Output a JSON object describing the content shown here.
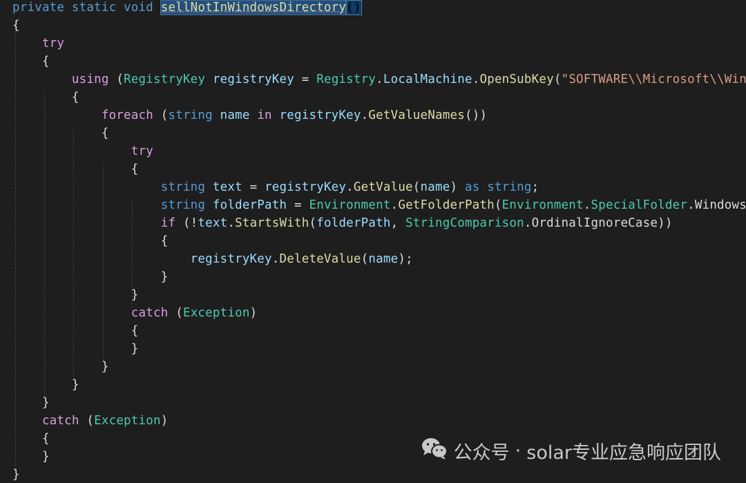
{
  "editor": {
    "lines": [
      [
        {
          "t": "private static void ",
          "c": "kw"
        },
        {
          "t": "sellNotInWindowsDirectory",
          "c": "sel"
        },
        {
          "t": "()",
          "c": "paren-hl"
        }
      ],
      [
        {
          "t": "{",
          "c": "pl"
        }
      ],
      [
        {
          "t": "    try",
          "c": "ctl"
        }
      ],
      [
        {
          "t": "    {",
          "c": "pl"
        }
      ],
      [
        {
          "t": "        using ",
          "c": "ctl"
        },
        {
          "t": "(",
          "c": "pl"
        },
        {
          "t": "RegistryKey ",
          "c": "type"
        },
        {
          "t": "registryKey ",
          "c": "id"
        },
        {
          "t": "= ",
          "c": "pl"
        },
        {
          "t": "Registry",
          "c": "type"
        },
        {
          "t": ".",
          "c": "pl"
        },
        {
          "t": "LocalMachine",
          "c": "id"
        },
        {
          "t": ".",
          "c": "pl"
        },
        {
          "t": "OpenSubKey",
          "c": "fn"
        },
        {
          "t": "(",
          "c": "pl"
        },
        {
          "t": "\"SOFTWARE\\\\Microsoft\\\\Windo",
          "c": "str"
        }
      ],
      [
        {
          "t": "        {",
          "c": "pl"
        }
      ],
      [
        {
          "t": "            foreach ",
          "c": "ctl"
        },
        {
          "t": "(",
          "c": "pl"
        },
        {
          "t": "string ",
          "c": "kw"
        },
        {
          "t": "name ",
          "c": "id"
        },
        {
          "t": "in ",
          "c": "ctl"
        },
        {
          "t": "registryKey",
          "c": "id"
        },
        {
          "t": ".",
          "c": "pl"
        },
        {
          "t": "GetValueNames",
          "c": "fn"
        },
        {
          "t": "())",
          "c": "pl"
        }
      ],
      [
        {
          "t": "            {",
          "c": "pl"
        }
      ],
      [
        {
          "t": "                try",
          "c": "ctl"
        }
      ],
      [
        {
          "t": "                {",
          "c": "pl"
        }
      ],
      [
        {
          "t": "                    string ",
          "c": "kw"
        },
        {
          "t": "text ",
          "c": "id"
        },
        {
          "t": "= ",
          "c": "pl"
        },
        {
          "t": "registryKey",
          "c": "id"
        },
        {
          "t": ".",
          "c": "pl"
        },
        {
          "t": "GetValue",
          "c": "fn"
        },
        {
          "t": "(",
          "c": "pl"
        },
        {
          "t": "name",
          "c": "id"
        },
        {
          "t": ") ",
          "c": "pl"
        },
        {
          "t": "as ",
          "c": "kw"
        },
        {
          "t": "string",
          "c": "kw"
        },
        {
          "t": ";",
          "c": "pl"
        }
      ],
      [
        {
          "t": "                    string ",
          "c": "kw"
        },
        {
          "t": "folderPath ",
          "c": "id"
        },
        {
          "t": "= ",
          "c": "pl"
        },
        {
          "t": "Environment",
          "c": "type"
        },
        {
          "t": ".",
          "c": "pl"
        },
        {
          "t": "GetFolderPath",
          "c": "fn"
        },
        {
          "t": "(",
          "c": "pl"
        },
        {
          "t": "Environment",
          "c": "type"
        },
        {
          "t": ".",
          "c": "pl"
        },
        {
          "t": "SpecialFolder",
          "c": "type"
        },
        {
          "t": ".",
          "c": "pl"
        },
        {
          "t": "Windows",
          "c": "pl"
        },
        {
          "t": ");",
          "c": "pl"
        }
      ],
      [
        {
          "t": "                    if ",
          "c": "ctl"
        },
        {
          "t": "(!",
          "c": "pl"
        },
        {
          "t": "text",
          "c": "id"
        },
        {
          "t": ".",
          "c": "pl"
        },
        {
          "t": "StartsWith",
          "c": "fn"
        },
        {
          "t": "(",
          "c": "pl"
        },
        {
          "t": "folderPath",
          "c": "id"
        },
        {
          "t": ", ",
          "c": "pl"
        },
        {
          "t": "StringComparison",
          "c": "type"
        },
        {
          "t": ".",
          "c": "pl"
        },
        {
          "t": "OrdinalIgnoreCase",
          "c": "pl"
        },
        {
          "t": "))",
          "c": "pl"
        }
      ],
      [
        {
          "t": "                    {",
          "c": "pl"
        }
      ],
      [
        {
          "t": "                        registryKey",
          "c": "id"
        },
        {
          "t": ".",
          "c": "pl"
        },
        {
          "t": "DeleteValue",
          "c": "fn"
        },
        {
          "t": "(",
          "c": "pl"
        },
        {
          "t": "name",
          "c": "id"
        },
        {
          "t": ");",
          "c": "pl"
        }
      ],
      [
        {
          "t": "                    }",
          "c": "pl"
        }
      ],
      [
        {
          "t": "                }",
          "c": "pl"
        }
      ],
      [
        {
          "t": "                catch ",
          "c": "ctl"
        },
        {
          "t": "(",
          "c": "pl"
        },
        {
          "t": "Exception",
          "c": "type"
        },
        {
          "t": ")",
          "c": "pl"
        }
      ],
      [
        {
          "t": "                {",
          "c": "pl"
        }
      ],
      [
        {
          "t": "                }",
          "c": "pl"
        }
      ],
      [
        {
          "t": "            }",
          "c": "pl"
        }
      ],
      [
        {
          "t": "        }",
          "c": "pl"
        }
      ],
      [
        {
          "t": "    }",
          "c": "pl"
        }
      ],
      [
        {
          "t": "    catch ",
          "c": "ctl"
        },
        {
          "t": "(",
          "c": "pl"
        },
        {
          "t": "Exception",
          "c": "type"
        },
        {
          "t": ")",
          "c": "pl"
        }
      ],
      [
        {
          "t": "    {",
          "c": "pl"
        }
      ],
      [
        {
          "t": "    }",
          "c": "pl"
        }
      ],
      [
        {
          "t": "}",
          "c": "pl"
        }
      ]
    ]
  },
  "colors": {
    "background": "#1e1e1e",
    "keyword": "#569cd6",
    "control": "#d8a0df",
    "type": "#4ec9b0",
    "identifier": "#9cdcfe",
    "method": "#dcdcaa",
    "string": "#d69d85",
    "selection": "#264f78"
  },
  "watermark": {
    "icon": "wechat-icon",
    "prefix": "公众号",
    "separator": "·",
    "account": "solar专业应急响应团队"
  }
}
